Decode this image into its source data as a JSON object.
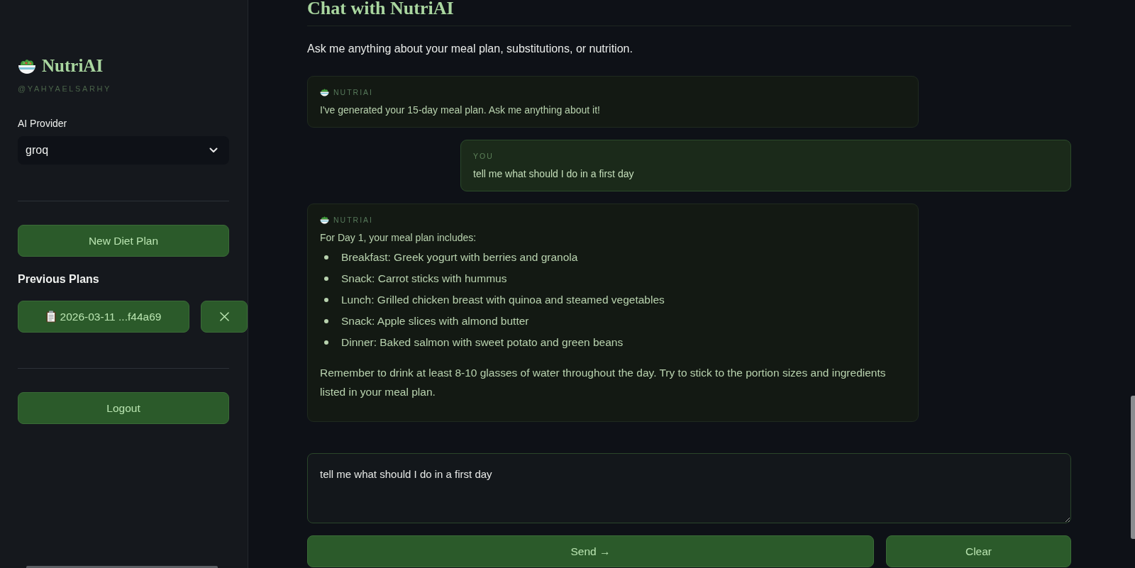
{
  "sidebar": {
    "brand": {
      "title": "NutriAI",
      "handle": "@YAHYAELSARHY"
    },
    "provider": {
      "label": "AI Provider",
      "value": "groq"
    },
    "new_plan_button": "New Diet Plan",
    "previous_plans": {
      "heading": "Previous Plans",
      "items": [
        {
          "label": "2026-03-11 ...f44a69"
        }
      ]
    },
    "logout_button": "Logout"
  },
  "chat": {
    "title": "Chat with NutriAI",
    "subtitle": "Ask me anything about your meal plan, substitutions, or nutrition.",
    "messages": [
      {
        "kind": "assistant",
        "sender": "NUTRIAI",
        "blocks": [
          {
            "kind": "line",
            "text": "I've generated your 15-day meal plan. Ask me anything about it!"
          }
        ]
      },
      {
        "kind": "user",
        "sender": "YOU",
        "blocks": [
          {
            "kind": "line",
            "text": "tell me what should I do in a first day"
          }
        ]
      },
      {
        "kind": "assistant",
        "sender": "NUTRIAI",
        "blocks": [
          {
            "kind": "line",
            "text": "For Day 1, your meal plan includes:"
          },
          {
            "kind": "list",
            "items": [
              "Breakfast: Greek yogurt with berries and granola",
              "Snack: Carrot sticks with hummus",
              "Lunch: Grilled chicken breast with quinoa and steamed vegetables",
              "Snack: Apple slices with almond butter",
              "Dinner: Baked salmon with sweet potato and green beans"
            ]
          },
          {
            "kind": "paragraph",
            "text": "Remember to drink at least 8-10 glasses of water throughout the day. Try to stick to the portion sizes and ingredients listed in your meal plan."
          }
        ]
      }
    ],
    "input": {
      "value": "tell me what should I do in a first day"
    },
    "send_button": "Send →",
    "clear_button": "Clear"
  }
}
